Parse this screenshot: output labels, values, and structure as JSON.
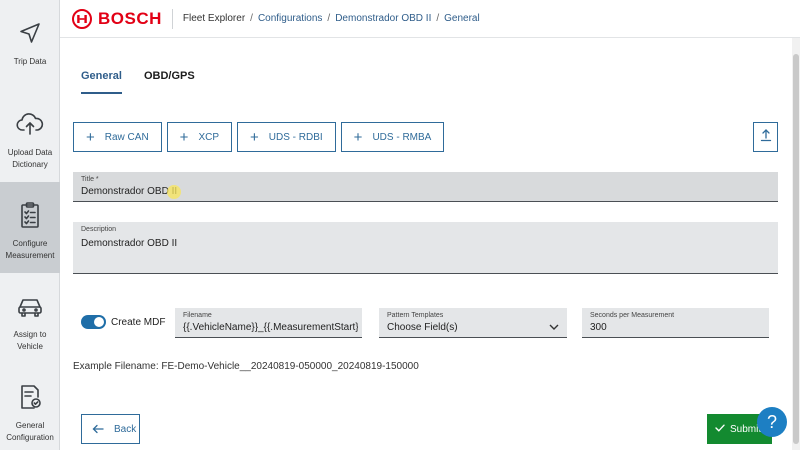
{
  "brand": {
    "name": "BOSCH",
    "color": "#e20015"
  },
  "breadcrumb": {
    "app": "Fleet Explorer",
    "items": [
      "Configurations",
      "Demonstrador OBD II",
      "General"
    ],
    "separator": "/"
  },
  "sidebar": {
    "items": [
      {
        "label": "Trip Data",
        "icon": "navigation-arrow-icon",
        "active": false
      },
      {
        "label": "Upload Data Dictionary",
        "icon": "cloud-upload-icon",
        "active": false
      },
      {
        "label": "Configure Measurement",
        "icon": "clipboard-checklist-icon",
        "active": true
      },
      {
        "label": "Assign to Vehicle",
        "icon": "car-icon",
        "active": false
      },
      {
        "label": "General Configuration",
        "icon": "document-check-icon",
        "active": false
      }
    ]
  },
  "tabs": [
    {
      "label": "General",
      "active": true
    },
    {
      "label": "OBD/GPS",
      "active": false
    }
  ],
  "add_buttons": [
    {
      "label": "Raw CAN",
      "icon": "plus-icon"
    },
    {
      "label": "XCP",
      "icon": "plus-icon"
    },
    {
      "label": "UDS - RDBI",
      "icon": "plus-icon"
    },
    {
      "label": "UDS - RMBA",
      "icon": "plus-icon"
    }
  ],
  "upload_button": {
    "icon": "upload-icon"
  },
  "form": {
    "title": {
      "label": "Title *",
      "value": "Demonstrador OBD II"
    },
    "description": {
      "label": "Description",
      "value": "Demonstrador OBD II"
    },
    "create_mdf": {
      "label": "Create MDF",
      "enabled": true
    },
    "filename": {
      "label": "Filename",
      "value": "{{.VehicleName}}_{{.MeasurementStart}}_"
    },
    "pattern_templates": {
      "label": "Pattern Templates",
      "value": "Choose Field(s)"
    },
    "seconds_per_measurement": {
      "label": "Seconds per Measurement",
      "value": "300"
    }
  },
  "example_filename": "Example Filename: FE-Demo-Vehicle__20240819-050000_20240819-150000",
  "footer": {
    "back_label": "Back",
    "submit_label": "Submit",
    "help_label": "?"
  },
  "colors": {
    "accent": "#2f6b9a",
    "submit": "#138a30",
    "help": "#1d7fc3",
    "sidebar_active": "#c9cdd1"
  }
}
